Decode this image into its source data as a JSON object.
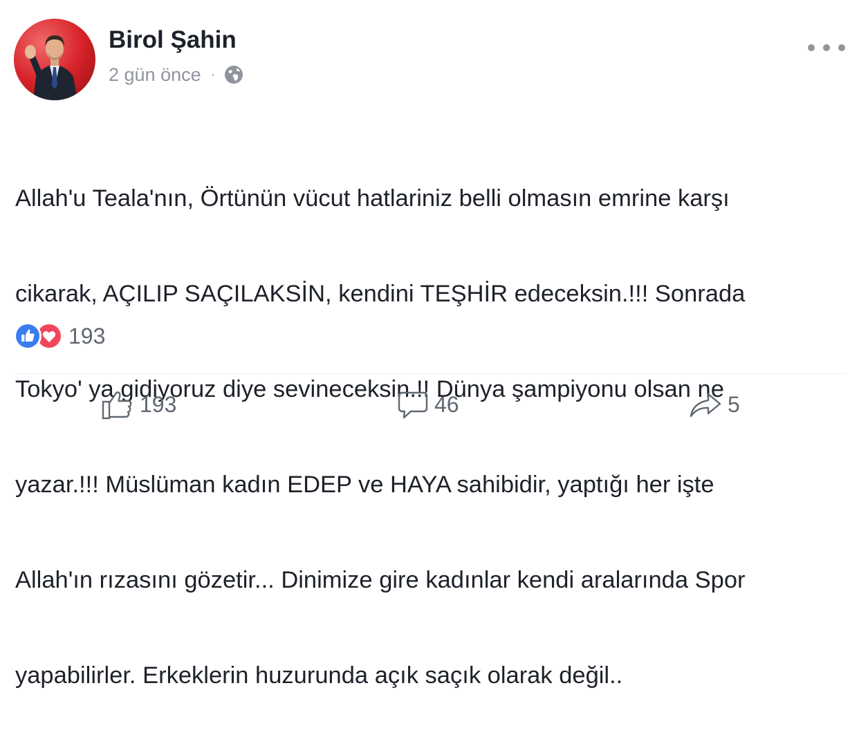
{
  "post": {
    "author_name": "Birol Şahin",
    "timestamp": "2 gün önce",
    "separator": "·",
    "privacy_icon": "globe-icon",
    "more_icon": "more-options-icon",
    "text_lines": [
      "Allah'u Teala'nın, Örtünün vücut hatlariniz belli olmasın emrine karşı",
      "cikarak, AÇILIP SAÇILAKSİN, kendini TEŞHİR edeceksin.!!! Sonrada",
      "Tokyo' ya gidiyoruz diye sevineceksin.!! Dünya şampiyonu olsan ne",
      "yazar.!!!  Müslüman kadın EDEP ve HAYA sahibidir, yaptığı her işte",
      "Allah'ın rızasını gözetir...  Dinimize gire kadınlar kendi aralarında Spor",
      "yapabilirler. Erkeklerin huzurunda açık saçık olarak değil.."
    ]
  },
  "reactions": {
    "icons": [
      "like-reaction-icon",
      "love-reaction-icon"
    ],
    "count": "193"
  },
  "actions": {
    "like": {
      "icon": "thumbs-up-icon",
      "count": "193"
    },
    "comment": {
      "icon": "comment-bubble-icon",
      "count": "46"
    },
    "share": {
      "icon": "share-arrow-icon",
      "count": "5"
    }
  },
  "colors": {
    "text": "#1d2129",
    "secondary_text": "#90949c",
    "action_text": "#606770",
    "like_blue": "#3b7cf0",
    "love_red": "#f0455a"
  }
}
